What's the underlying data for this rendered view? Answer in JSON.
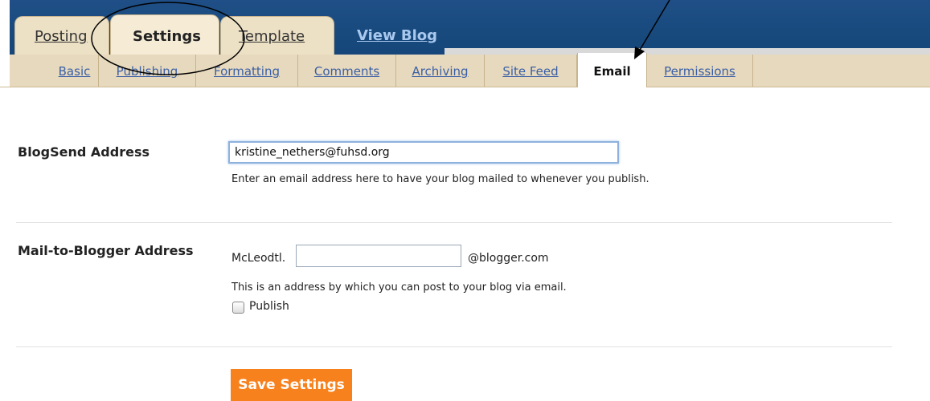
{
  "main_tabs": {
    "posting": "Posting",
    "settings": "Settings",
    "template": "Template",
    "view_blog": "View Blog"
  },
  "sub_tabs": [
    "Basic",
    "Publishing",
    "Formatting",
    "Comments",
    "Archiving",
    "Site Feed",
    "Email",
    "Permissions"
  ],
  "active_sub_tab": "Email",
  "blogsend": {
    "label": "BlogSend Address",
    "value": "kristine_nethers@fuhsd.org",
    "hint": "Enter an email address here to have your blog mailed to whenever you publish."
  },
  "mail_to_blogger": {
    "label": "Mail-to-Blogger Address",
    "prefix": "McLeodtl.",
    "value": "",
    "suffix": "@blogger.com",
    "hint": "This is an address by which you can post to your blog via email.",
    "publish_label": "Publish",
    "publish_checked": false
  },
  "save_button": "Save Settings"
}
